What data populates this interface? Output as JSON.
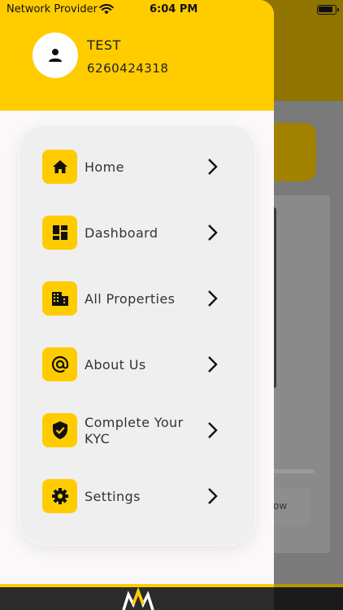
{
  "status_bar": {
    "carrier": "Network Provider",
    "time": "6:04 PM"
  },
  "user": {
    "name": "TEST",
    "phone": "6260424318"
  },
  "menu": {
    "items": [
      {
        "label": "Home",
        "icon": "home-icon"
      },
      {
        "label": "Dashboard",
        "icon": "dashboard-icon"
      },
      {
        "label": "All Properties",
        "icon": "building-icon"
      },
      {
        "label": "About Us",
        "icon": "at-sign-icon"
      },
      {
        "label": "Complete Your KYC",
        "icon": "verified-shield-icon"
      },
      {
        "label": "Settings",
        "icon": "gear-icon"
      }
    ]
  },
  "background": {
    "button_text": "ow"
  },
  "colors": {
    "accent": "#ffcc00",
    "drawer_bg": "#fbf8fa",
    "card_bg": "#efefef",
    "text": "#333333"
  }
}
